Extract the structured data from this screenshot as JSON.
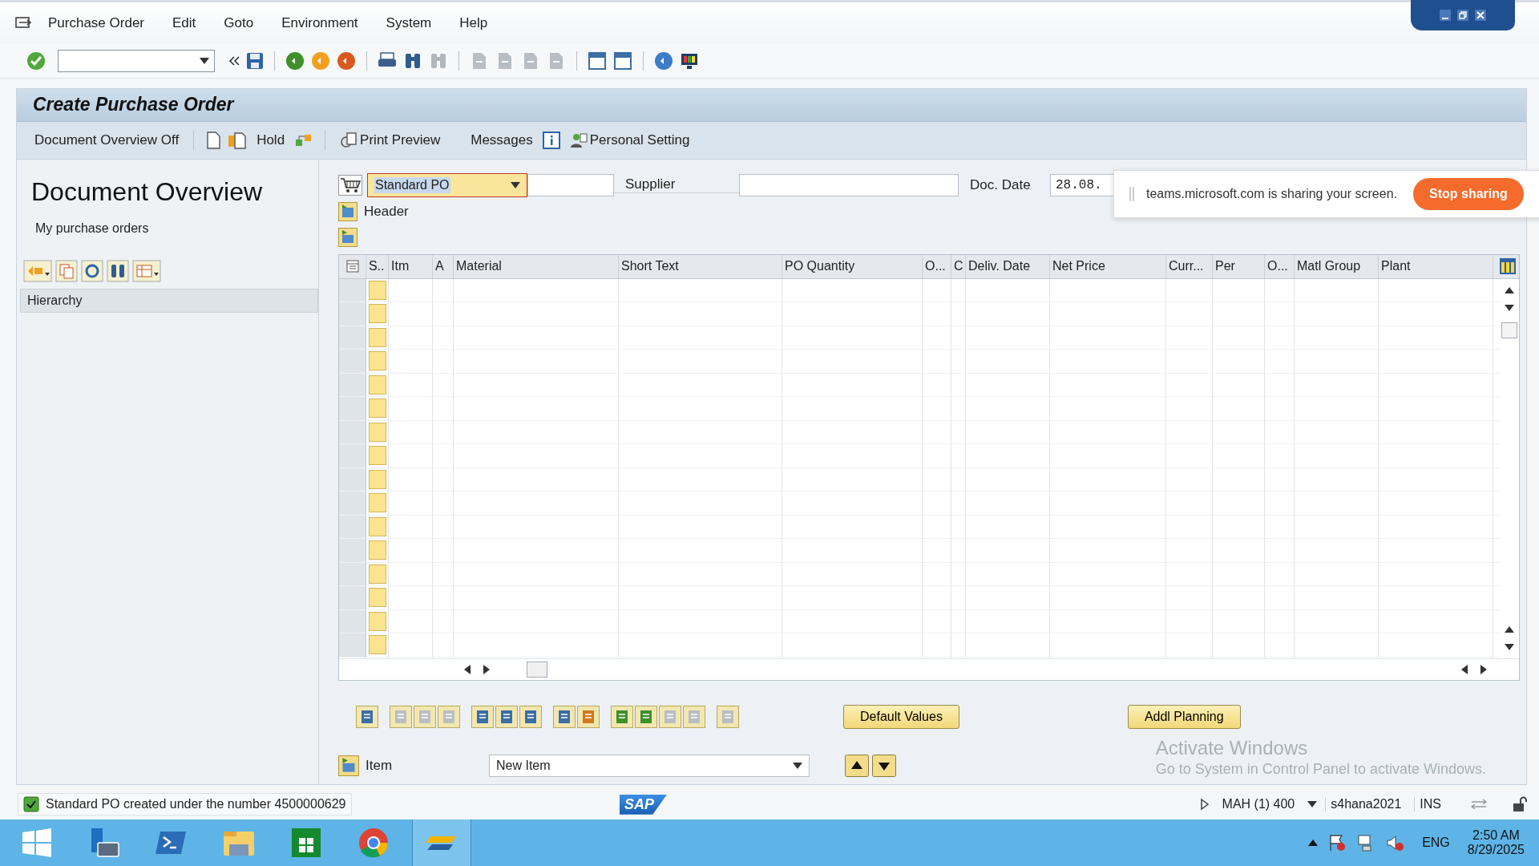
{
  "menu": [
    {
      "label": "Purchase Order"
    },
    {
      "label": "Edit"
    },
    {
      "label": "Goto"
    },
    {
      "label": "Environment"
    },
    {
      "label": "System"
    },
    {
      "label": "Help"
    }
  ],
  "title": "Create Purchase Order",
  "app_toolbar": {
    "overview_toggle": "Document Overview Off",
    "hold": "Hold",
    "print_preview": "Print Preview",
    "messages": "Messages",
    "personal_setting": "Personal Setting"
  },
  "overview": {
    "title": "Document Overview",
    "variant": "My purchase orders",
    "tree_header": "Hierarchy"
  },
  "header": {
    "doc_type": "Standard PO",
    "supplier_label": "Supplier",
    "doc_date_label": "Doc. Date",
    "doc_date": "28.08.",
    "section": "Header"
  },
  "items_table": {
    "columns": [
      "S..",
      "Itm",
      "A",
      "Material",
      "Short Text",
      "PO Quantity",
      "O...",
      "C",
      "Deliv. Date",
      "Net Price",
      "Curr...",
      "Per",
      "O...",
      "Matl Group",
      "Plant"
    ]
  },
  "buttons": [
    "Default Values",
    "Addl Planning"
  ],
  "item_section": {
    "label": "Item",
    "selection": "New Item"
  },
  "status_bar": {
    "message": {
      "kind": "success",
      "text": "Standard PO created under the number 4500000629"
    },
    "logo": "SAP",
    "system": "MAH (1) 400",
    "server": "s4hana2021",
    "mode": "INS"
  },
  "screen_share": {
    "text": "teams.microsoft.com is sharing your screen.",
    "button": "Stop sharing"
  },
  "activation": {
    "title": "Activate Windows",
    "text": "Go to System in Control Panel to activate Windows."
  },
  "taskbar": {
    "language": "ENG",
    "time": "2:50 AM",
    "date": "8/29/2025"
  }
}
